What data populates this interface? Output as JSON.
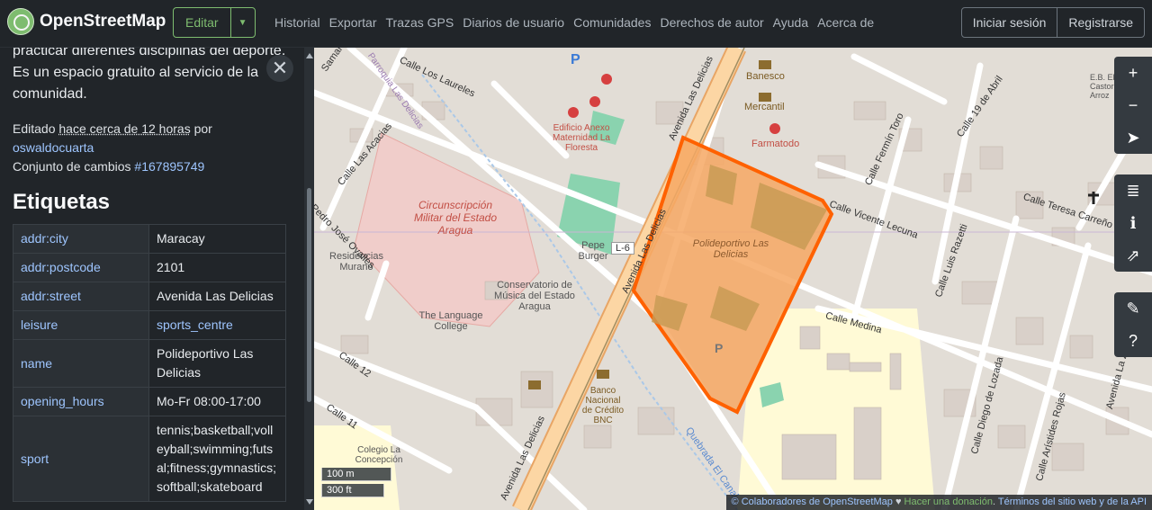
{
  "header": {
    "brand": "OpenStreetMap",
    "edit_label": "Editar",
    "nav": [
      "Historial",
      "Exportar",
      "Trazas GPS",
      "Diarios de usuario",
      "Comunidades",
      "Derechos de autor",
      "Ayuda",
      "Acerca de"
    ],
    "login": "Iniciar sesión",
    "signup": "Registrarse"
  },
  "sidebar": {
    "description": "practicar diferentes disciplinas del deporte. Es un espacio gratuito al servicio de la comunidad.",
    "edited_prefix": "Editado",
    "edited_time": "hace cerca de 12 horas",
    "edited_by": "por",
    "user": "oswaldocuarta",
    "changeset_prefix": "Conjunto de cambios",
    "changeset": "#167895749",
    "tags_heading": "Etiquetas",
    "tags": [
      {
        "k": "addr:city",
        "v": "Maracay"
      },
      {
        "k": "addr:postcode",
        "v": "2101"
      },
      {
        "k": "addr:street",
        "v": "Avenida Las Delicias"
      },
      {
        "k": "leisure",
        "v": "sports_centre"
      },
      {
        "k": "name",
        "v": "Polideportivo Las Delicias"
      },
      {
        "k": "opening_hours",
        "v": "Mo-Fr 08:00-17:00"
      },
      {
        "k": "sport",
        "v": "tennis;basketball;volleyball;swimming;futsal;fitness;gymnastics;softball;skateboard"
      }
    ]
  },
  "map": {
    "labels": {
      "circunscripcion": "Circunscripción Militar del Estado Aragua",
      "polideportivo": "Polideportivo Las Delicias",
      "conservatorio": "Conservatorio de Música del Estado Aragua",
      "language_college": "The Language College",
      "residencias": "Residencias Murano",
      "edificio": "Edificio Anexo Maternidad La Floresta",
      "banesco": "Banesco",
      "mercantil": "Mercantil",
      "farmatodo": "Farmatodo",
      "banco": "Banco Nacional de Crédito BNC",
      "pepe": "Pepe Burger",
      "colegio": "Colegio La Concepción",
      "l6": "L-6",
      "av_delicias": "Avenida Las Delicias",
      "calle_medina": "Calle Medina",
      "calle_vicente": "Calle Vicente Lecuna",
      "calle_teresa": "Calle Teresa Carreño",
      "calle_fermin": "Calle Fermín Toro",
      "calle_razzetti": "Calle Luis Razetti",
      "calle_diego": "Calle Diego de Lozada",
      "calle_aristides": "Calle Arístides Rojas",
      "calle_19abril": "Calle 19 de Abril",
      "calle_laureles": "Calle Los Laureles",
      "calle_acacias": "Calle Las Acacias",
      "pedro_jose": "Pedro José Ovalles",
      "calle12": "Calle 12",
      "calle11": "Calle 11",
      "quebrada": "Quebrada El Canal",
      "parroquia": "Parroquia Las Delicias",
      "samanes": "Samanes",
      "ebe": "E.B. El Castor Arroz",
      "av_zuloaga": "Avenida La Zooaga",
      "p": "P"
    },
    "scale_m": "100 m",
    "scale_ft": "300 ft",
    "attribution": {
      "copy": "© Colaboradores de OpenStreetMap",
      "heart": "♥",
      "donate": "Hacer una donación",
      "terms": "Términos del sitio web y de la API"
    },
    "controls": [
      "zoom-in-icon",
      "zoom-out-icon",
      "locate-icon",
      "layers-icon",
      "info-icon",
      "share-icon",
      "note-icon",
      "query-icon"
    ]
  }
}
